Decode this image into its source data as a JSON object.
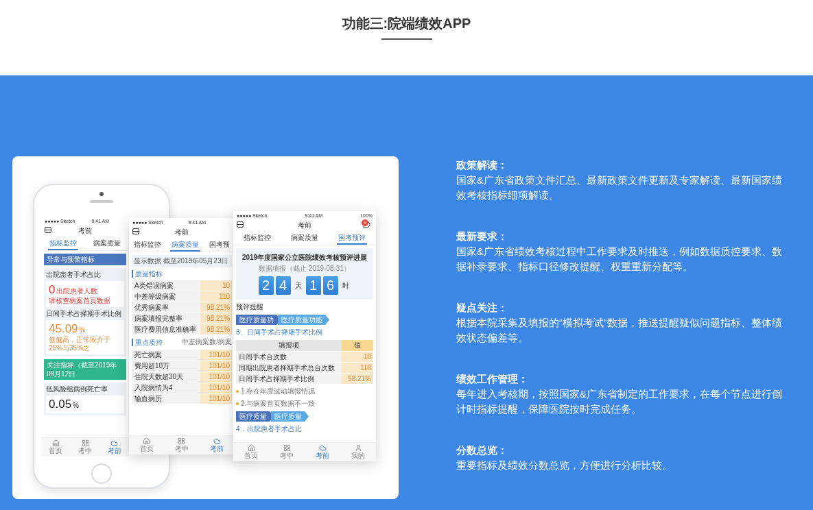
{
  "header": {
    "title": "功能三:院端绩效APP"
  },
  "phone_monitor": {
    "status": {
      "carrier": "●●●●● Sketch",
      "time": "9:41 AM"
    },
    "title": "考前",
    "tabs": [
      {
        "label": "指标监控",
        "selected": true
      },
      {
        "label": "病案质量",
        "selected": false
      }
    ],
    "sections": [
      {
        "kind": "alert",
        "title": "异常与预警指标",
        "metrics": [
          {
            "kind": "alert",
            "title": "出院患者手术占比",
            "value": "0",
            "unit": "出院患者人数",
            "note": "请核查病案首页数据"
          },
          {
            "kind": "warning",
            "title": "日间手术占择期手术比例",
            "value": "45.09",
            "unit": "%",
            "note": "值偏高，正常应介于25%与35%之"
          }
        ]
      },
      {
        "kind": "focus",
        "title": "关注指标（截至2019年08月12日",
        "metrics": [
          {
            "kind": "normal",
            "title": "低风险组病例死亡率",
            "value": "0.05",
            "unit": "%"
          }
        ]
      }
    ],
    "tab_bar": [
      {
        "kind": "home",
        "label": "首页",
        "selected": false
      },
      {
        "kind": "grid",
        "label": "考中",
        "selected": false
      },
      {
        "kind": "cloud",
        "label": "考前",
        "selected": true
      }
    ]
  },
  "phone_quality": {
    "status": {
      "carrier": "●●●●● Sketch",
      "time": "9:41 AM"
    },
    "title": "考前",
    "tabs": [
      {
        "label": "指标监控",
        "selected": false
      },
      {
        "label": "病案质量",
        "selected": true
      },
      {
        "label": "国考预",
        "selected": false
      }
    ],
    "filter": {
      "label": "显示数据",
      "value": "截至2019年05月23日"
    },
    "groups": [
      {
        "title": "质量指标",
        "rows": [
          {
            "label": "A类错误病案",
            "value": "10"
          },
          {
            "label": "中差等级病案",
            "value": "110"
          },
          {
            "label": "优秀病案率",
            "value": "98.21%"
          },
          {
            "label": "病案填报完整率",
            "value": "98.21%"
          },
          {
            "label": "医疗费用信息准确率",
            "value": "98.21%"
          }
        ]
      },
      {
        "title": "重点质控",
        "note": "中差病案数/病案",
        "rows": [
          {
            "label": "死亡病案",
            "value": "101/10"
          },
          {
            "label": "费用超10万",
            "value": "101/10"
          },
          {
            "label": "住院天数超30天",
            "value": "101/10"
          },
          {
            "label": "入院病情为4",
            "value": "101/10"
          },
          {
            "label": "输血病历",
            "value": "101/10"
          }
        ]
      }
    ],
    "tab_bar": [
      {
        "kind": "home",
        "label": "首页",
        "selected": false
      },
      {
        "kind": "grid",
        "label": "考中",
        "selected": false
      },
      {
        "kind": "cloud",
        "label": "考前",
        "selected": true
      }
    ]
  },
  "phone_forecast": {
    "status": {
      "carrier": "●●●●● Sketch",
      "time": "9:41 AM",
      "battery": "100%"
    },
    "title": "考前",
    "badge": "1",
    "tabs": [
      {
        "label": "指标监控",
        "selected": false
      },
      {
        "label": "病案质量",
        "selected": false
      },
      {
        "label": "国考预评",
        "selected": true
      }
    ],
    "countdown": {
      "title": "2019年度国家公立医院绩效考核预评进展",
      "subtitle": "数据填报（截止 2019-08-31）",
      "days": [
        "2",
        "4"
      ],
      "day_unit": "天",
      "hours": [
        "1",
        "6"
      ],
      "hour_unit": "时"
    },
    "reminder_title": "预评提醒",
    "blocks": [
      {
        "steps": [
          "医疗质量功",
          "医疗质量功能"
        ],
        "heading": "3、日间手术占择期手术比例",
        "table": {
          "columns": [
            "填报项",
            "值"
          ],
          "rows": [
            [
              "日间手术台次数",
              "10"
            ],
            [
              "同期出院患者择期手术总台次数",
              "110"
            ],
            [
              "日间手术占择期手术比例",
              "98.21%"
            ]
          ]
        },
        "notes": [
          "1.存在年度波动填报情况",
          "2.与病案首页数据不一致"
        ]
      },
      {
        "steps": [
          "医疗质量",
          "医疗质量"
        ],
        "heading": "4．出院患者手术占比"
      }
    ],
    "tab_bar": [
      {
        "kind": "home",
        "label": "首页",
        "selected": false
      },
      {
        "kind": "grid",
        "label": "考中",
        "selected": false
      },
      {
        "kind": "cloud",
        "label": "考前",
        "selected": true
      },
      {
        "kind": "person",
        "label": "我的",
        "selected": false
      }
    ]
  },
  "features": [
    {
      "title": "政策解读：",
      "text": "国家&广东省政策文件汇总、最新政策文件更新及专家解读、最新国家绩效考核指标细项解读。"
    },
    {
      "title": "最新要求：",
      "text": "国家&广东省绩效考核过程中工作要求及时推送，例如数据质控要求、数据补录要求、指标口径修改提醒、权重重新分配等。"
    },
    {
      "title": "疑点关注：",
      "text": "根据本院采集及填报的“模拟考试”数据，推送提醒疑似问题指标、整体绩效状态偏差等。"
    },
    {
      "title": "绩效工作管理：",
      "text": "每年进入考核期，按照国家&广东省制定的工作要求，在每个节点进行倒计时指标提醒，保障医院按时完成任务。"
    },
    {
      "title": "分数总览：",
      "text": "重要指标及绩效分数总览，方便进行分析比较。"
    }
  ]
}
